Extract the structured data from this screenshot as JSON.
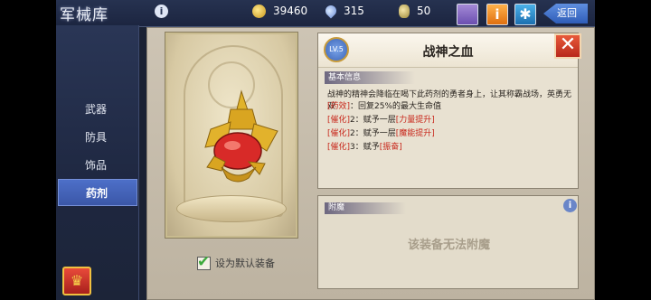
{
  "header": {
    "title": "军械库",
    "resources": [
      {
        "name": "gold",
        "icon": "gold-coin-icon",
        "value": "39460"
      },
      {
        "name": "gem",
        "icon": "crystal-drop-icon",
        "value": "315"
      },
      {
        "name": "feather",
        "icon": "feather-icon",
        "value": "50"
      }
    ],
    "back_label": "返回"
  },
  "sidebar": {
    "items": [
      {
        "label": "武器",
        "active": false
      },
      {
        "label": "防具",
        "active": false
      },
      {
        "label": "饰品",
        "active": false
      },
      {
        "label": "药剂",
        "active": true
      }
    ]
  },
  "item": {
    "level": "LV.5",
    "name": "战神之血",
    "section_basic": "基本信息",
    "description": "战神的精神会降临在喝下此药剂的勇者身上，让其称霸战场，英勇无双",
    "effects": [
      {
        "tag": "[药效]",
        "text": "：回复25%的最大生命值",
        "highlight": ""
      },
      {
        "tag": "[催化]",
        "text": "2：赋予一层",
        "highlight": "[力量提升]"
      },
      {
        "tag": "[催化]",
        "text": "2：赋予一层",
        "highlight": "[魔能提升]"
      },
      {
        "tag": "[催化]",
        "text": "3：赋予",
        "highlight": "[振奋]"
      }
    ],
    "default_label": "设为默认装备",
    "default_checked": true
  },
  "enchant": {
    "section": "附魔",
    "message": "该装备无法附魔"
  },
  "colors": {
    "accent_blue": "#3b57a8",
    "highlight_red": "#c8281c",
    "panel_bg": "#e8e1d1"
  }
}
